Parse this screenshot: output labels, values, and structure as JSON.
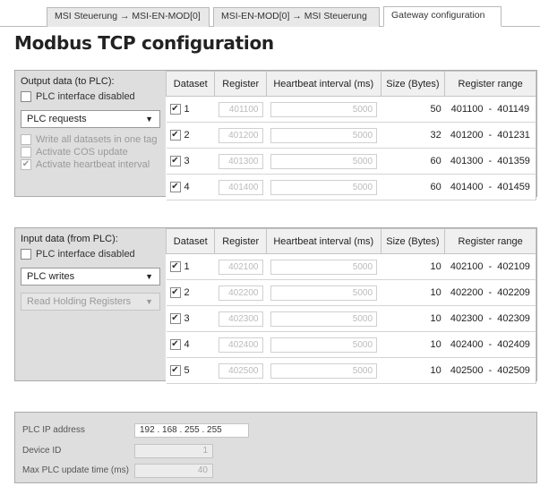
{
  "tabs": [
    {
      "label": "MSI Steuerung → MSI-EN-MOD[0]",
      "active": false
    },
    {
      "label": "MSI-EN-MOD[0] → MSI Steuerung",
      "active": false
    },
    {
      "label": "Gateway configuration",
      "active": true
    }
  ],
  "page_title": "Modbus TCP configuration",
  "columns": [
    "Dataset",
    "Register",
    "Heartbeat interval (ms)",
    "Size (Bytes)",
    "Register range"
  ],
  "output": {
    "title": "Output data (to PLC):",
    "plc_disabled_label": "PLC interface disabled",
    "plc_disabled_checked": false,
    "mode_select": "PLC requests",
    "options": [
      {
        "label": "Write all datasets in one tag",
        "checked": false
      },
      {
        "label": "Activate COS update",
        "checked": false
      },
      {
        "label": "Activate heartbeat interval",
        "checked": true
      }
    ],
    "rows": [
      {
        "dataset": "1",
        "checked": true,
        "register": "401100",
        "heartbeat": "5000",
        "size": "50",
        "range_start": "401100",
        "range_end": "401149"
      },
      {
        "dataset": "2",
        "checked": true,
        "register": "401200",
        "heartbeat": "5000",
        "size": "32",
        "range_start": "401200",
        "range_end": "401231"
      },
      {
        "dataset": "3",
        "checked": true,
        "register": "401300",
        "heartbeat": "5000",
        "size": "60",
        "range_start": "401300",
        "range_end": "401359"
      },
      {
        "dataset": "4",
        "checked": true,
        "register": "401400",
        "heartbeat": "5000",
        "size": "60",
        "range_start": "401400",
        "range_end": "401459"
      }
    ]
  },
  "input": {
    "title": "Input data (from PLC):",
    "plc_disabled_label": "PLC interface disabled",
    "plc_disabled_checked": false,
    "mode_select": "PLC writes",
    "function_select": "Read Holding Registers",
    "rows": [
      {
        "dataset": "1",
        "checked": true,
        "register": "402100",
        "heartbeat": "5000",
        "size": "10",
        "range_start": "402100",
        "range_end": "402109"
      },
      {
        "dataset": "2",
        "checked": true,
        "register": "402200",
        "heartbeat": "5000",
        "size": "10",
        "range_start": "402200",
        "range_end": "402209"
      },
      {
        "dataset": "3",
        "checked": true,
        "register": "402300",
        "heartbeat": "5000",
        "size": "10",
        "range_start": "402300",
        "range_end": "402309"
      },
      {
        "dataset": "4",
        "checked": true,
        "register": "402400",
        "heartbeat": "5000",
        "size": "10",
        "range_start": "402400",
        "range_end": "402409"
      },
      {
        "dataset": "5",
        "checked": true,
        "register": "402500",
        "heartbeat": "5000",
        "size": "10",
        "range_start": "402500",
        "range_end": "402509"
      }
    ]
  },
  "plc": {
    "ip_label": "PLC IP address",
    "ip_value": "192 . 168 . 255 . 255",
    "device_id_label": "Device ID",
    "device_id_value": "1",
    "max_update_label": "Max PLC update time (ms)",
    "max_update_value": "40"
  },
  "colors": {
    "panel_bg": "#dedede",
    "border": "#aaaaaa",
    "disabled_text": "#999999"
  },
  "icons": {
    "check": "check-mark",
    "dropdown": "down-triangle"
  }
}
